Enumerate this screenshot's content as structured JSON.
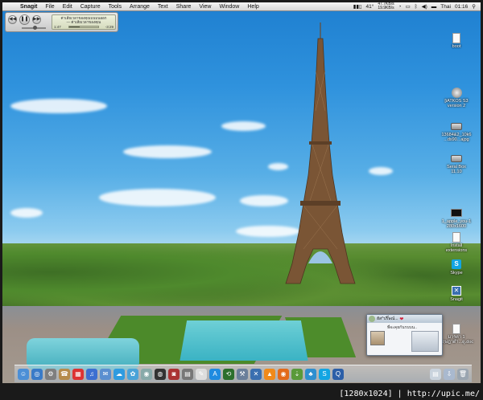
{
  "menubar": {
    "apple": "",
    "app": "Snagit",
    "items": [
      "File",
      "Edit",
      "Capture",
      "Tools",
      "Arrange",
      "Text",
      "Share",
      "View",
      "Window",
      "Help"
    ],
    "status": {
      "temperature": "41°",
      "network_top": "47.7KB/s",
      "network_bottom": "19.9KB/s",
      "language": "Thai",
      "clock": "01:16"
    }
  },
  "player": {
    "line1": "ค่าเสียเวลาของคุณบนบนออก",
    "line2": "— ค่าเสียเวลาของคุณ",
    "elapsed": "1:47",
    "remaining": "-3:29",
    "progress": 0.35,
    "volume": 0.55
  },
  "desktop_icons": [
    {
      "label": "boot",
      "icon": "document-icon"
    },
    {
      "label": "[iATKOS S3\nversion 2",
      "icon": "apple-disk-icon"
    },
    {
      "label": "13684&2_10k6\n...ds90...ajpg",
      "icon": "drive-icon"
    },
    {
      "label": "Seral Box\n11.10",
      "icon": "drive-icon"
    },
    {
      "label": "1_apple_you-1\n280x1600",
      "icon": "image-icon"
    },
    {
      "label": "Install\nextensions",
      "icon": "document-icon"
    },
    {
      "label": "Skype",
      "icon": "skype-icon"
    },
    {
      "label": "Snagit",
      "icon": "snagit-icon"
    },
    {
      "label": "มารค่า 1\nกฤษฎาดำ...ดู.doc",
      "icon": "document-icon"
    }
  ],
  "chat": {
    "name": "ฮัส^ปริ๊ษณ์...",
    "message": "พี่จะคุยกันรบบน..",
    "heart": "❤"
  },
  "watermark": "[1280x1024]",
  "watermark_site": "http://upic.me/",
  "dock_apps": [
    "finder-icon",
    "safari-icon",
    "system-prefs-icon",
    "address-book-icon",
    "ical-icon",
    "itunes-icon",
    "mail-icon",
    "ichat-icon",
    "iphoto-icon",
    "preview-icon",
    "dashboard-icon",
    "photo-booth-icon",
    "calculator-icon",
    "textedit-icon",
    "app-store-icon",
    "time-machine-icon",
    "utilities-icon",
    "snagit-icon",
    "vlc-icon",
    "firefox-icon",
    "bittorrent-icon",
    "msn-icon",
    "skype-icon",
    "quicktime-icon",
    "documents-stack-icon",
    "downloads-stack-icon",
    "trash-icon"
  ],
  "colors": {
    "menubar_bg": "#e6e6e6",
    "sky_top": "#1e7fd0",
    "accent": "#12a5e3"
  }
}
